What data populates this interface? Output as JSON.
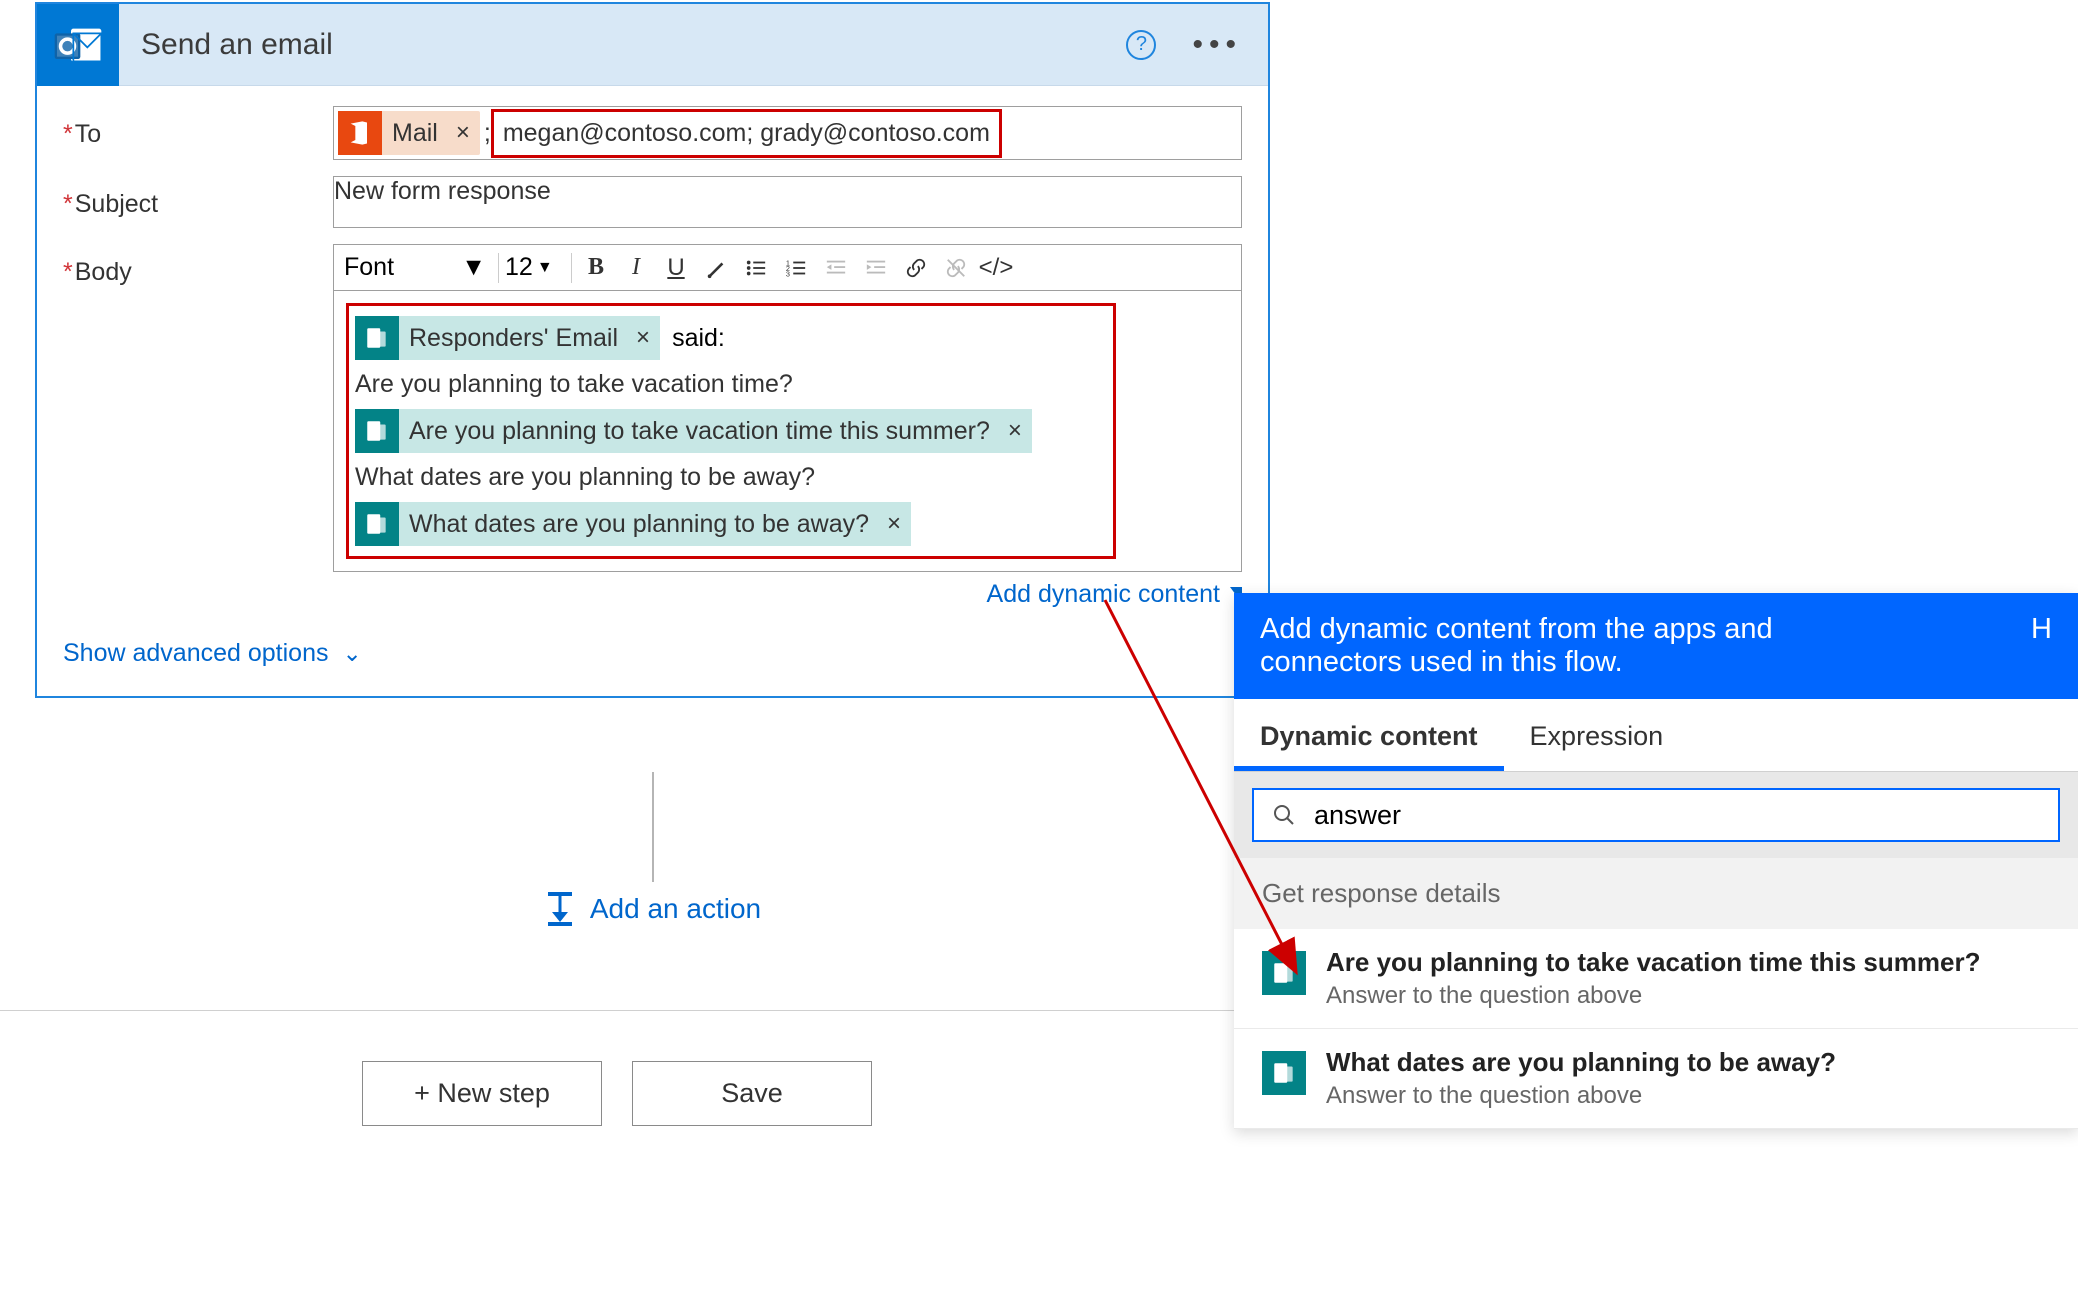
{
  "card": {
    "title": "Send an email",
    "fields": {
      "to": {
        "label": "To",
        "token_label": "Mail",
        "emails": "megan@contoso.com; grady@contoso.com"
      },
      "subject": {
        "label": "Subject",
        "value": "New form response"
      },
      "body": {
        "label": "Body",
        "toolbar": {
          "font": "Font",
          "size": "12"
        },
        "content": {
          "token1": "Responders' Email",
          "said": "said:",
          "line1": "Are you planning to take vacation time?",
          "token2": "Are you planning to take vacation time this summer?",
          "line2": "What dates are you planning to be away?",
          "token3": "What dates are you planning to be away?"
        },
        "add_dynamic": "Add dynamic content"
      }
    },
    "advanced": "Show advanced options"
  },
  "add_action": "Add an action",
  "buttons": {
    "new_step": "+ New step",
    "save": "Save"
  },
  "dynamic_panel": {
    "header": "Add dynamic content from the apps and connectors used in this flow.",
    "header_help": "H",
    "tabs": {
      "dynamic": "Dynamic content",
      "expression": "Expression"
    },
    "search_value": "answer",
    "section": "Get response details",
    "items": [
      {
        "title": "Are you planning to take vacation time this summer?",
        "sub": "Answer to the question above"
      },
      {
        "title": "What dates are you planning to be away?",
        "sub": "Answer to the question above"
      }
    ]
  }
}
